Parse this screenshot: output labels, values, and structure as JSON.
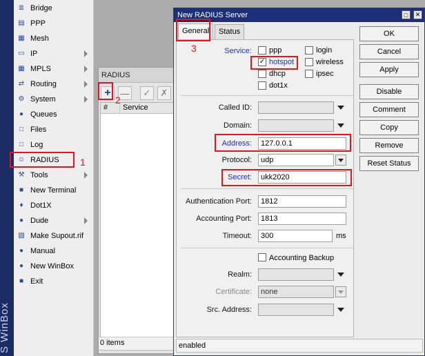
{
  "brand": "S WinBox",
  "sidebar": {
    "items": [
      {
        "label": "Bridge",
        "icon": "bridge-icon",
        "glyph": "≣",
        "arrow": false
      },
      {
        "label": "PPP",
        "icon": "ppp-icon",
        "glyph": "▤",
        "arrow": false
      },
      {
        "label": "Mesh",
        "icon": "mesh-icon",
        "glyph": "▦",
        "arrow": false
      },
      {
        "label": "IP",
        "icon": "ip-icon",
        "glyph": "▭",
        "arrow": true
      },
      {
        "label": "MPLS",
        "icon": "mpls-icon",
        "glyph": "▦",
        "arrow": true
      },
      {
        "label": "Routing",
        "icon": "routing-icon",
        "glyph": "⇄",
        "arrow": true
      },
      {
        "label": "System",
        "icon": "system-icon",
        "glyph": "⚙",
        "arrow": true
      },
      {
        "label": "Queues",
        "icon": "queues-icon",
        "glyph": "●",
        "arrow": false
      },
      {
        "label": "Files",
        "icon": "files-icon",
        "glyph": "□",
        "arrow": false
      },
      {
        "label": "Log",
        "icon": "log-icon",
        "glyph": "□",
        "arrow": false
      },
      {
        "label": "RADIUS",
        "icon": "radius-icon",
        "glyph": "☺",
        "arrow": false
      },
      {
        "label": "Tools",
        "icon": "tools-icon",
        "glyph": "⚒",
        "arrow": true
      },
      {
        "label": "New Terminal",
        "icon": "terminal-icon",
        "glyph": "■",
        "arrow": false
      },
      {
        "label": "Dot1X",
        "icon": "dot1x-icon",
        "glyph": "♦",
        "arrow": false
      },
      {
        "label": "Dude",
        "icon": "dude-icon",
        "glyph": "●",
        "arrow": true
      },
      {
        "label": "Make Supout.rif",
        "icon": "supout-icon",
        "glyph": "▧",
        "arrow": false
      },
      {
        "label": "Manual",
        "icon": "manual-icon",
        "glyph": "●",
        "arrow": false
      },
      {
        "label": "New WinBox",
        "icon": "winbox-icon",
        "glyph": "●",
        "arrow": false
      },
      {
        "label": "Exit",
        "icon": "exit-icon",
        "glyph": "■",
        "arrow": false
      }
    ]
  },
  "markers": {
    "one": "1",
    "two": "2",
    "three": "3"
  },
  "radius_window": {
    "title": "RADIUS",
    "columns": [
      "#",
      "Service"
    ],
    "status": "0 items"
  },
  "dialog": {
    "title": "New RADIUS Server",
    "tabs": [
      "General",
      "Status"
    ],
    "service": {
      "label": "Service:",
      "options": [
        {
          "label": "ppp",
          "checked": false
        },
        {
          "label": "login",
          "checked": false
        },
        {
          "label": "hotspot",
          "checked": true
        },
        {
          "label": "wireless",
          "checked": false
        },
        {
          "label": "dhcp",
          "checked": false
        },
        {
          "label": "ipsec",
          "checked": false
        },
        {
          "label": "dot1x",
          "checked": false
        }
      ]
    },
    "called_id": {
      "label": "Called ID:",
      "value": ""
    },
    "domain": {
      "label": "Domain:",
      "value": ""
    },
    "address": {
      "label": "Address:",
      "value": "127.0.0.1"
    },
    "protocol": {
      "label": "Protocol:",
      "value": "udp"
    },
    "secret": {
      "label": "Secret:",
      "value": "ukk2020"
    },
    "auth_port": {
      "label": "Authentication Port:",
      "value": "1812"
    },
    "acct_port": {
      "label": "Accounting Port:",
      "value": "1813"
    },
    "timeout": {
      "label": "Timeout:",
      "value": "300",
      "unit": "ms"
    },
    "accounting_backup": {
      "label": "Accounting Backup",
      "checked": false
    },
    "realm": {
      "label": "Realm:",
      "value": ""
    },
    "certificate": {
      "label": "Certificate:",
      "value": "none"
    },
    "src_address": {
      "label": "Src. Address:",
      "value": ""
    },
    "buttons": [
      "OK",
      "Cancel",
      "Apply",
      "Disable",
      "Comment",
      "Copy",
      "Remove",
      "Reset Status"
    ],
    "status": "enabled"
  },
  "colors": {
    "highlight": "#e0151f",
    "title_bar": "#1e2f7a",
    "link_blue": "#1f2fb6"
  }
}
